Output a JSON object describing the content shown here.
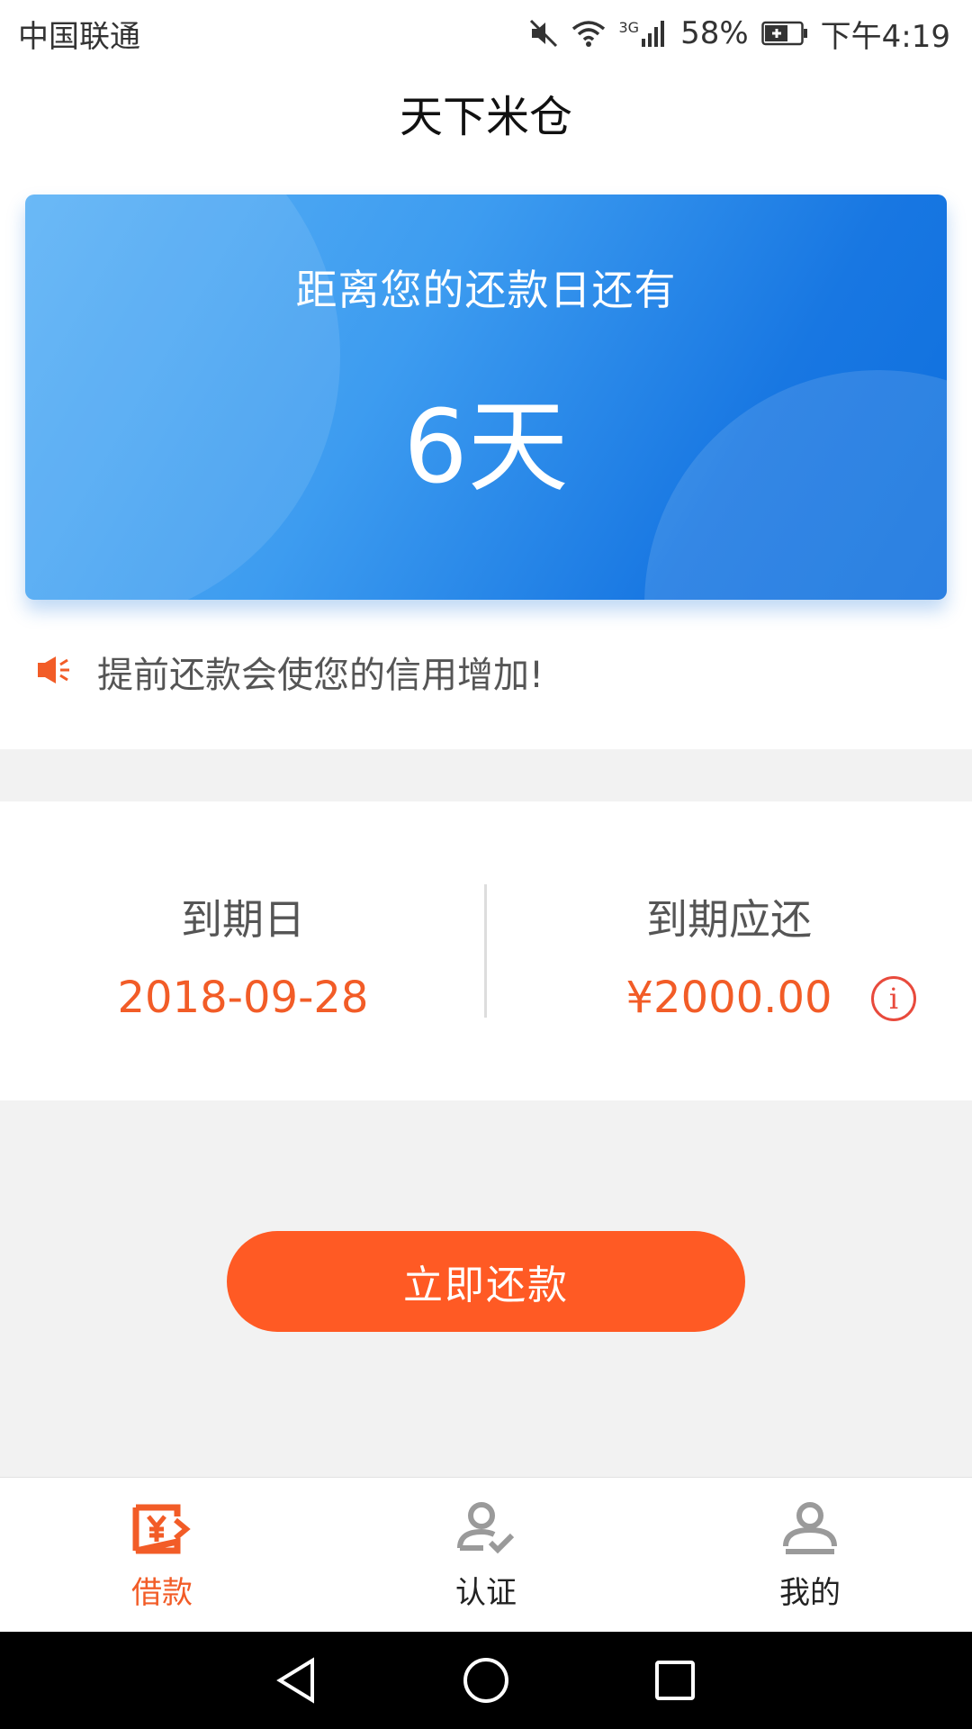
{
  "status_bar": {
    "carrier": "中国联通",
    "network": "3G",
    "battery": "58%",
    "time": "下午4:19"
  },
  "header": {
    "title": "天下米仓"
  },
  "countdown_card": {
    "label": "距离您的还款日还有",
    "days": "6天"
  },
  "tip": {
    "icon": "speaker-icon",
    "text": "提前还款会使您的信用增加!"
  },
  "due_info": {
    "date_label": "到期日",
    "date_value": "2018-09-28",
    "amount_label": "到期应还",
    "amount_value": "¥2000.00",
    "info_icon": "i"
  },
  "repay_button": {
    "label": "立即还款"
  },
  "tabs": [
    {
      "label": "借款",
      "icon": "loan-icon",
      "active": true
    },
    {
      "label": "认证",
      "icon": "verify-icon",
      "active": false
    },
    {
      "label": "我的",
      "icon": "profile-icon",
      "active": false
    }
  ],
  "colors": {
    "accent": "#ff5a24",
    "highlight_text": "#f25c27",
    "card_blue": "#1877e2"
  }
}
